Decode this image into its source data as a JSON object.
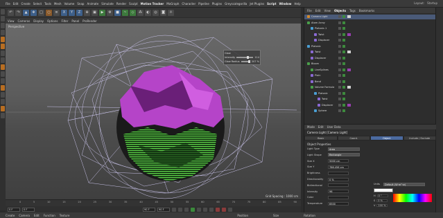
{
  "menubar": {
    "items": [
      "File",
      "Edit",
      "Create",
      "Select",
      "Tools",
      "Mesh",
      "Volume",
      "Snap",
      "Animate",
      "Simulate",
      "Render",
      "Sculpt",
      "Motion Tracker",
      "MoGraph",
      "Character",
      "Pipeline",
      "Plugins",
      "Greyscalegorilla",
      "Jet Plugins",
      "Script",
      "Window",
      "Help"
    ],
    "layout_label": "Layout:",
    "layout_value": "Startup"
  },
  "viewport": {
    "menu": [
      "View",
      "Cameras",
      "Display",
      "Options",
      "Filter",
      "Panel",
      "ProRender"
    ],
    "label": "Perspective",
    "grid_spacing": "Grid Spacing : 1000 cm",
    "hud": {
      "title": "Glow",
      "rows": [
        {
          "label": "Intensity",
          "value": "114"
        },
        {
          "label": "Glow Radius",
          "value": "207 %"
        }
      ]
    }
  },
  "timeline": {
    "ticks": [
      "0",
      "5",
      "10",
      "15",
      "20",
      "25",
      "30",
      "35",
      "40",
      "45",
      "50",
      "55",
      "60",
      "65",
      "70",
      "75",
      "80",
      "85",
      "90"
    ],
    "frame_field": "0 F",
    "start_field": "0 F",
    "end_field": "90 F",
    "end_frame": "90 F"
  },
  "bottombar": {
    "items": [
      "Create",
      "Camera",
      "Edit",
      "Function",
      "Texture"
    ],
    "coord_labels": [
      "Position",
      "Size",
      "Rotation"
    ]
  },
  "objects": {
    "tabs": [
      "File",
      "Edit",
      "View",
      "Objects",
      "Tags",
      "Bookmarks"
    ],
    "active_tab": "Objects",
    "rows": [
      {
        "label": "Camera Light",
        "indent": 0,
        "color": "#d48a2a"
      },
      {
        "label": "Atom Array",
        "indent": 0,
        "color": "#4a9f4a"
      },
      {
        "label": "Platonic.1",
        "indent": 1,
        "color": "#4a9fd4"
      },
      {
        "label": "Twist",
        "indent": 2,
        "color": "#8a6ad4"
      },
      {
        "label": "Displacer",
        "indent": 2,
        "color": "#8a6ad4"
      },
      {
        "label": "Platonic",
        "indent": 0,
        "color": "#4a9fd4"
      },
      {
        "label": "Twist",
        "indent": 1,
        "color": "#8a6ad4"
      },
      {
        "label": "Displacer",
        "indent": 1,
        "color": "#8a6ad4"
      },
      {
        "label": "Bloom",
        "indent": 0,
        "color": "#4a9f4a"
      },
      {
        "label": "LineSplines",
        "indent": 1,
        "color": "#4a9f4a"
      },
      {
        "label": "Plain",
        "indent": 1,
        "color": "#8a6ad4"
      },
      {
        "label": "Bend",
        "indent": 1,
        "color": "#8a6ad4"
      },
      {
        "label": "Volume Formula",
        "indent": 1,
        "color": "#4a9f4a"
      },
      {
        "label": "Platonic",
        "indent": 2,
        "color": "#4a9fd4"
      },
      {
        "label": "Twist",
        "indent": 3,
        "color": "#8a6ad4"
      },
      {
        "label": "Displacer",
        "indent": 3,
        "color": "#8a6ad4"
      },
      {
        "label": "Sphere",
        "indent": 2,
        "color": "#4a9fd4"
      }
    ]
  },
  "attributes": {
    "top_tabs": [
      "Mode",
      "Edit",
      "User Data"
    ],
    "title": "Camera Light [Camera Light]",
    "tabs": [
      "Basic",
      "Coord.",
      "Object",
      "Include / Exclude"
    ],
    "active_tab": "Object",
    "section": "Object Properties",
    "rows": [
      {
        "label": "Light Type",
        "kind": "dd",
        "value": "Area"
      },
      {
        "label": "Light Shape",
        "kind": "dd",
        "value": "Rectangle"
      },
      {
        "label": "Size X",
        "kind": "val",
        "value": "5000 cm"
      },
      {
        "label": "Size Y",
        "kind": "val",
        "value": "786.456 cm"
      },
      {
        "label": "Brightness",
        "kind": "val",
        "value": ""
      },
      {
        "label": "Directionality",
        "kind": "val",
        "value": "0 %"
      },
      {
        "label": "Bidirectional",
        "kind": "val",
        "value": ""
      },
      {
        "label": "Intensity",
        "kind": "val",
        "value": "96"
      },
      {
        "label": "Color",
        "kind": "val",
        "value": ""
      },
      {
        "label": "Temperature",
        "kind": "val",
        "value": "6500"
      }
    ],
    "units_label": "Units",
    "units_value": "Default (W·m²·sr)",
    "color_rows": [
      {
        "label": "H",
        "value": "0 °"
      },
      {
        "label": "S",
        "value": "0 %"
      },
      {
        "label": "V",
        "value": "100 %"
      }
    ]
  }
}
